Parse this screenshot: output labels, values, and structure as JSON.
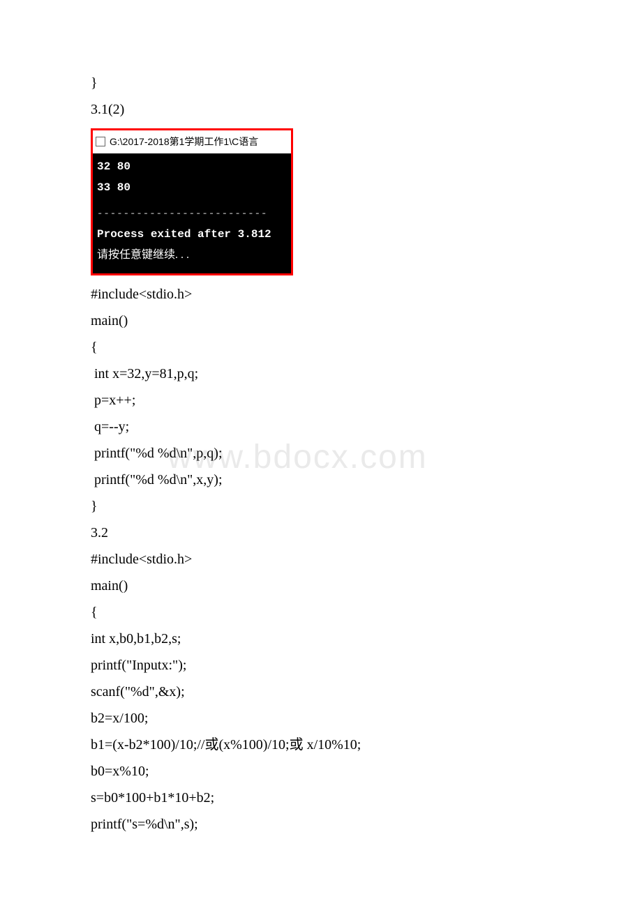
{
  "section1": {
    "l1": "}",
    "l2": "3.1(2)"
  },
  "screenshot": {
    "title": " G:\\2017-2018第1学期工作1\\C语言",
    "out1": "32 80",
    "out2": "33 80",
    "dashes": "--------------------------",
    "exit": "Process exited after 3.812",
    "prompt": "请按任意键继续. . ."
  },
  "code1": {
    "l1": "#include<stdio.h>",
    "l2": "main()",
    "l3": "{",
    "l4": " int x=32,y=81,p,q;",
    "l5": " p=x++;",
    "l6": " q=--y;",
    "l7": " printf(\"%d %d\\n\",p,q);",
    "l8": " printf(\"%d %d\\n\",x,y);",
    "l9": "}"
  },
  "section2": {
    "h": "3.2"
  },
  "code2": {
    "l1": "#include<stdio.h>",
    "l2": "main()",
    "l3": "{",
    "l4": "int x,b0,b1,b2,s;",
    "l5": "printf(\"Inputx:\");",
    "l6": "scanf(\"%d\",&x);",
    "l7": "b2=x/100;",
    "l8": "b1=(x-b2*100)/10;//或(x%100)/10;或 x/10%10;",
    "l9": "b0=x%10;",
    "l10": "s=b0*100+b1*10+b2;",
    "l11": "printf(\"s=%d\\n\",s);"
  },
  "watermark": "www.bdocx.com"
}
